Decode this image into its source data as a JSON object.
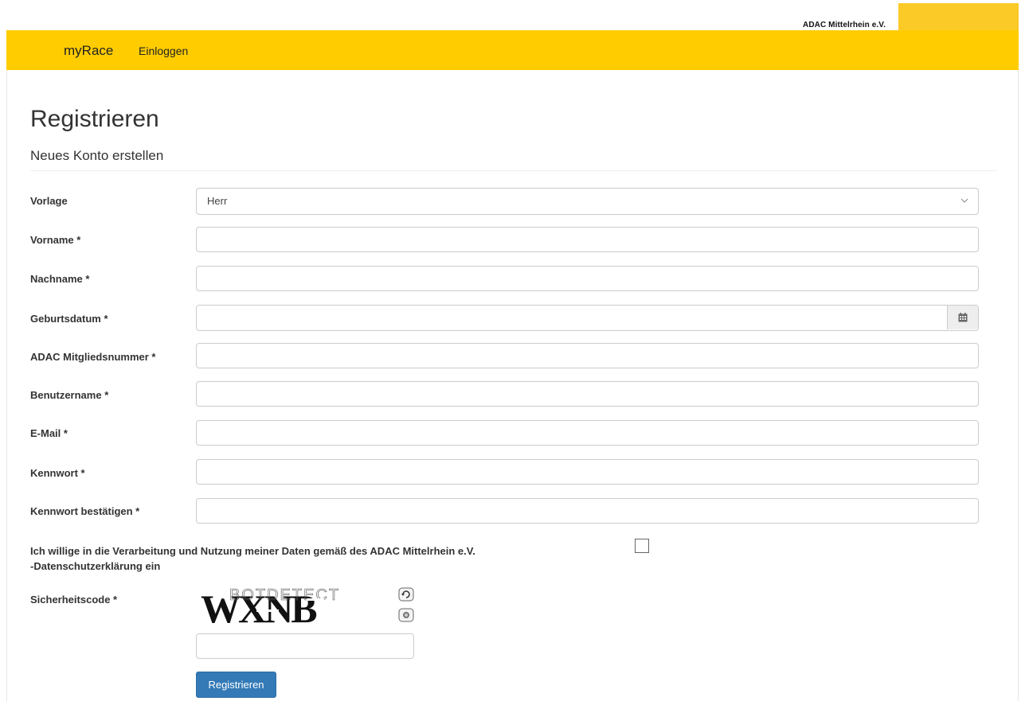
{
  "header": {
    "org_name": "ADAC Mittelrhein e.V.",
    "nav_brand": "myRace",
    "nav_login": "Einloggen",
    "brand_color": "#ffcc00"
  },
  "page": {
    "title": "Registrieren",
    "subtitle": "Neues Konto erstellen"
  },
  "form": {
    "vorlage": {
      "label": "Vorlage",
      "value": "Herr"
    },
    "vorname": {
      "label": "Vorname *",
      "value": ""
    },
    "nachname": {
      "label": "Nachname *",
      "value": ""
    },
    "geburtsdatum": {
      "label": "Geburtsdatum *",
      "value": "",
      "icon": "calendar-icon"
    },
    "mitgliedsnummer": {
      "label": "ADAC Mitgliedsnummer *",
      "value": ""
    },
    "benutzername": {
      "label": "Benutzername *",
      "value": ""
    },
    "email": {
      "label": "E-Mail *",
      "value": ""
    },
    "kennwort": {
      "label": "Kennwort *",
      "value": ""
    },
    "kennwort_bestaetigen": {
      "label": "Kennwort bestätigen *",
      "value": ""
    },
    "consent": {
      "line1": "Ich willige in die Verarbeitung und Nutzung meiner Daten gemäß des ADAC Mittelrhein e.V.",
      "line2": "-Datenschutzerklärung ein",
      "checked": false
    },
    "captcha": {
      "label": "Sicherheitscode *",
      "code_text": "WXNB",
      "watermark": "BOTDETECT",
      "value": ""
    },
    "submit_label": "Registrieren",
    "submit_color": "#337ab7"
  }
}
